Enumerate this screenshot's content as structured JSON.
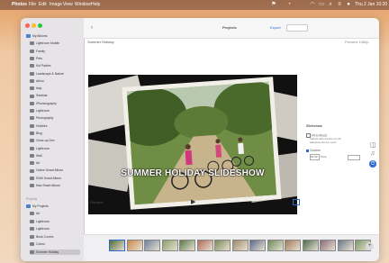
{
  "menubar": {
    "app": "Photos",
    "menus": [
      "File",
      "Edit",
      "Image",
      "View",
      "Window",
      "Help"
    ],
    "clock": "Thu 2 Jan 10:20"
  },
  "sidebar": {
    "library_label": "My Albums",
    "items": [
      {
        "label": "My Albums",
        "icon": "folder-icon"
      },
      {
        "label": "Lightroom Mobile",
        "icon": "album-icon"
      },
      {
        "label": "Family",
        "icon": "album-icon"
      },
      {
        "label": "Pets",
        "icon": "album-icon"
      },
      {
        "label": "Kid Parties",
        "icon": "album-icon"
      },
      {
        "label": "Landscape & Nature",
        "icon": "album-icon"
      },
      {
        "label": "Africa",
        "icon": "album-icon"
      },
      {
        "label": "Italy",
        "icon": "album-icon"
      },
      {
        "label": "Sardinia",
        "icon": "album-icon"
      },
      {
        "label": "iPhoneography",
        "icon": "album-icon"
      },
      {
        "label": "Lightroom",
        "icon": "album-icon"
      },
      {
        "label": "Photography",
        "icon": "album-icon"
      },
      {
        "label": "Hobbies",
        "icon": "album-icon"
      },
      {
        "label": "Blog",
        "icon": "album-icon"
      },
      {
        "label": "Close-up Dev",
        "icon": "album-icon"
      },
      {
        "label": "Lightroom",
        "icon": "album-icon"
      },
      {
        "label": "Wall",
        "icon": "album-icon"
      },
      {
        "label": "Art",
        "icon": "album-icon"
      },
      {
        "label": "Online Smart Album",
        "icon": "smart-album-icon"
      },
      {
        "label": "RAW Smart Album",
        "icon": "smart-album-icon"
      },
      {
        "label": "Mac Smart Album",
        "icon": "smart-album-icon"
      }
    ],
    "projects_heading": "Projects",
    "projects_group": "My Projects",
    "projects": [
      {
        "label": "Art",
        "selected": false
      },
      {
        "label": "Lightroom",
        "selected": false
      },
      {
        "label": "Lightroom",
        "selected": false
      },
      {
        "label": "Book Covers",
        "selected": false
      },
      {
        "label": "Colors",
        "selected": false
      },
      {
        "label": "Summer Holiday",
        "selected": true
      }
    ]
  },
  "toolbar": {
    "title": "Projects",
    "project_name": "Summer Holiday",
    "right_label": "Export",
    "right_info": "Preview 1080p"
  },
  "slideshow": {
    "title_overlay": "SUMMER HOLIDAY SLIDESHOW",
    "controls_left": "Preview"
  },
  "inspector": {
    "heading": "Slideshow",
    "checkbox1": "Fit to Music",
    "desc": "Adjusts slide duration so the slideshow fits the music",
    "checkbox2": "Custom",
    "time_value": "00:00",
    "time_unit": "Time",
    "accent": "#2d6ad1"
  },
  "filmstrip": {
    "count": 15,
    "add_label": "+"
  }
}
